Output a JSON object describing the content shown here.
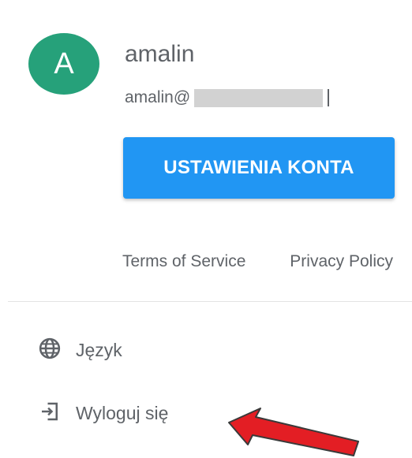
{
  "profile": {
    "avatar_letter": "A",
    "avatar_color": "#26a17a",
    "username": "amalin",
    "email_prefix": "amalin@"
  },
  "actions": {
    "account_settings_label": "USTAWIENIA KONTA",
    "button_color": "#2196f3"
  },
  "footer_links": {
    "terms": "Terms of Service",
    "privacy": "Privacy Policy"
  },
  "menu": {
    "items": [
      {
        "label": "Język",
        "icon": "globe-icon"
      },
      {
        "label": "Wyloguj się",
        "icon": "logout-icon"
      }
    ]
  },
  "annotation": {
    "arrow_color": "#e31e24",
    "arrow_target": "logout"
  }
}
